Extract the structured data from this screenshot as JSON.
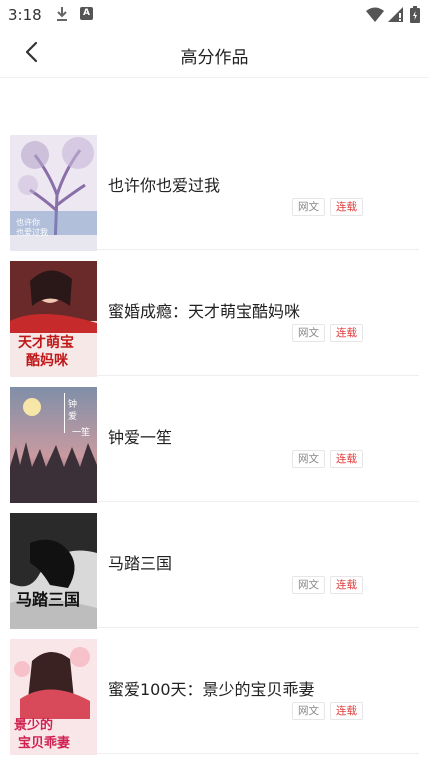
{
  "status_bar": {
    "time": "3:18",
    "icons": [
      "download-icon",
      "a-app-icon",
      "wifi-icon",
      "signal-icon",
      "battery-icon"
    ]
  },
  "header": {
    "title": "高分作品",
    "back_icon": "chevron-left-icon"
  },
  "books": [
    {
      "title": "也许你也爱过我",
      "type_tag": "网文",
      "status_tag": "连载",
      "cover_text": "也许你 也爱过我"
    },
    {
      "title": "蜜婚成瘾：天才萌宝酷妈咪",
      "type_tag": "网文",
      "status_tag": "连载",
      "cover_text": "天才萌宝 酷妈咪"
    },
    {
      "title": "钟爱一笙",
      "type_tag": "网文",
      "status_tag": "连载",
      "cover_text": "钟爱 一笙"
    },
    {
      "title": "马踏三国",
      "type_tag": "网文",
      "status_tag": "连载",
      "cover_text": "马踏三国"
    },
    {
      "title": "蜜爱100天：景少的宝贝乖妻",
      "type_tag": "网文",
      "status_tag": "连载",
      "cover_text": "景少的 宝贝乖妻"
    }
  ],
  "colors": {
    "status_tag": "#e23b3b",
    "type_tag": "#888888",
    "divider": "#eeeeee"
  }
}
